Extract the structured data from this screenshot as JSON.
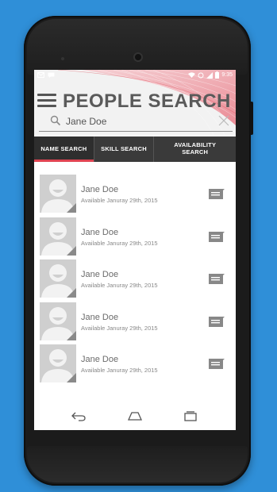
{
  "header": {
    "title": "PEOPLE SEARCH",
    "search_value": "Jane Doe",
    "status_time": "9:35"
  },
  "tabs": [
    {
      "label": "NAME SEARCH",
      "active": true
    },
    {
      "label": "SKILL SEARCH",
      "active": false
    },
    {
      "label": "AVAILABILITY SEARCH",
      "active": false
    }
  ],
  "results": [
    {
      "name": "Jane Doe",
      "availability": "Available Januray 29th, 2015"
    },
    {
      "name": "Jane Doe",
      "availability": "Available Januray 29th, 2015"
    },
    {
      "name": "Jane Doe",
      "availability": "Available Januray 29th, 2015"
    },
    {
      "name": "Jane Doe",
      "availability": "Available Januray 29th, 2015"
    },
    {
      "name": "Jane Doe",
      "availability": "Available Januray 29th, 2015"
    }
  ],
  "icons": {
    "menu": "hamburger-icon",
    "search": "search-icon",
    "clear": "close-icon",
    "message": "message-icon",
    "back": "back-icon",
    "home": "home-icon",
    "recents": "recents-icon"
  },
  "colors": {
    "background": "#2f8fd8",
    "accent": "#e04452",
    "tab_bar": "#3a3a3a"
  }
}
